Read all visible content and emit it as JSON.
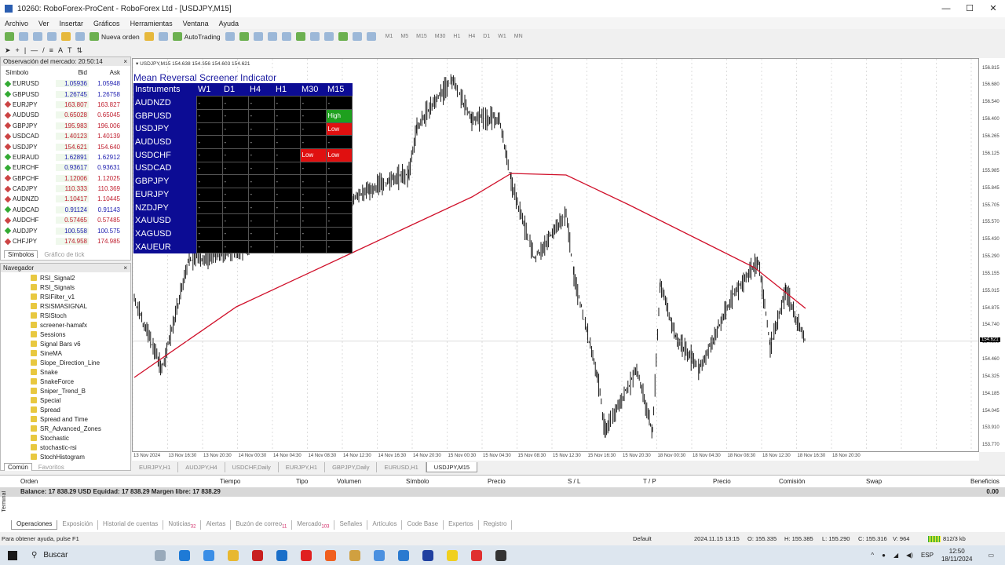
{
  "window": {
    "title": "10260: RoboForex-ProCent - RoboForex Ltd - [USDJPY,M15]",
    "min": "—",
    "max": "☐",
    "close": "✕"
  },
  "menu": [
    "Archivo",
    "Ver",
    "Insertar",
    "Gráficos",
    "Herramientas",
    "Ventana",
    "Ayuda"
  ],
  "toolbar": {
    "new_order": "Nueva orden",
    "autotrading": "AutoTrading",
    "timeframes": [
      "M1",
      "M5",
      "M15",
      "M30",
      "H1",
      "H4",
      "D1",
      "W1",
      "MN"
    ]
  },
  "market_watch": {
    "title": "Observación del mercado: 20:50:14",
    "col_symbol": "Símbolo",
    "col_bid": "Bid",
    "col_ask": "Ask",
    "rows": [
      {
        "symbol": "EURUSD",
        "bid": "1.05936",
        "ask": "1.05948",
        "dir": "up"
      },
      {
        "symbol": "GBPUSD",
        "bid": "1.26745",
        "ask": "1.26758",
        "dir": "up"
      },
      {
        "symbol": "EURJPY",
        "bid": "163.807",
        "ask": "163.827",
        "dir": "down"
      },
      {
        "symbol": "AUDUSD",
        "bid": "0.65028",
        "ask": "0.65045",
        "dir": "down"
      },
      {
        "symbol": "GBPJPY",
        "bid": "195.983",
        "ask": "196.006",
        "dir": "down"
      },
      {
        "symbol": "USDCAD",
        "bid": "1.40123",
        "ask": "1.40139",
        "dir": "down"
      },
      {
        "symbol": "USDJPY",
        "bid": "154.621",
        "ask": "154.640",
        "dir": "down"
      },
      {
        "symbol": "EURAUD",
        "bid": "1.62891",
        "ask": "1.62912",
        "dir": "up"
      },
      {
        "symbol": "EURCHF",
        "bid": "0.93617",
        "ask": "0.93631",
        "dir": "up"
      },
      {
        "symbol": "GBPCHF",
        "bid": "1.12006",
        "ask": "1.12025",
        "dir": "down"
      },
      {
        "symbol": "CADJPY",
        "bid": "110.333",
        "ask": "110.369",
        "dir": "down"
      },
      {
        "symbol": "AUDNZD",
        "bid": "1.10417",
        "ask": "1.10445",
        "dir": "down"
      },
      {
        "symbol": "AUDCAD",
        "bid": "0.91124",
        "ask": "0.91143",
        "dir": "up"
      },
      {
        "symbol": "AUDCHF",
        "bid": "0.57465",
        "ask": "0.57485",
        "dir": "down"
      },
      {
        "symbol": "AUDJPY",
        "bid": "100.558",
        "ask": "100.575",
        "dir": "up"
      },
      {
        "symbol": "CHFJPY",
        "bid": "174.958",
        "ask": "174.985",
        "dir": "down"
      }
    ],
    "tabs": [
      "Símbolos",
      "Gráfico de tick"
    ]
  },
  "navigator": {
    "title": "Navegador",
    "items": [
      "RSI_Signal2",
      "RSI_Signals",
      "RSIFilter_v1",
      "RSISMASIGNAL",
      "RSIStoch",
      "screener-hamafx",
      "Sessions",
      "Signal Bars v6",
      "SineMA",
      "Slope_Direction_Line",
      "Snake",
      "SnakeForce",
      "Sniper_Trend_B",
      "Special",
      "Spread",
      "Spread and Time",
      "SR_Advanced_Zones",
      "Stochastic",
      "stochastic-rsi",
      "StochHistogram"
    ],
    "tabs": [
      "Común",
      "Favoritos"
    ]
  },
  "chart": {
    "info": "▾ USDJPY,M15  154.638 154.656 154.603 154.621",
    "current_price": "154.621",
    "price_labels": [
      "156.815",
      "156.680",
      "156.540",
      "156.400",
      "156.265",
      "156.125",
      "155.985",
      "155.845",
      "155.705",
      "155.570",
      "155.430",
      "155.290",
      "155.155",
      "155.015",
      "154.875",
      "154.740",
      "154.600",
      "154.460",
      "154.325",
      "154.185",
      "154.045",
      "153.910",
      "153.770"
    ],
    "time_labels": [
      "13 Nov 2024",
      "13 Nov 16:30",
      "13 Nov 20:30",
      "14 Nov 00:30",
      "14 Nov 04:30",
      "14 Nov 08:30",
      "14 Nov 12:30",
      "14 Nov 16:30",
      "14 Nov 20:30",
      "15 Nov 00:30",
      "15 Nov 04:30",
      "15 Nov 08:30",
      "15 Nov 12:30",
      "15 Nov 16:30",
      "15 Nov 20:30",
      "18 Nov 00:30",
      "18 Nov 04:30",
      "18 Nov 08:30",
      "18 Nov 12:30",
      "18 Nov 16:30",
      "18 Nov 20:30"
    ],
    "price_color": "#000000",
    "ma_color": "#d0102a",
    "tabs": [
      "EURJPY,H1",
      "AUDJPY,H4",
      "USDCHF,Daily",
      "EURJPY,H1",
      "GBPJPY,Daily",
      "EURUSD,H1",
      "USDJPY,M15"
    ]
  },
  "screener": {
    "title": "Mean Reversal Screener Indicator",
    "header": [
      "Instruments",
      "W1",
      "D1",
      "H4",
      "H1",
      "M30",
      "M15"
    ],
    "rows": [
      {
        "sym": "AUDNZD",
        "cells": [
          "-",
          "-",
          "-",
          "-",
          "-",
          "-"
        ]
      },
      {
        "sym": "GBPUSD",
        "cells": [
          "-",
          "-",
          "-",
          "-",
          "-",
          "High"
        ]
      },
      {
        "sym": "USDJPY",
        "cells": [
          "-",
          "-",
          "-",
          "-",
          "-",
          "Low"
        ]
      },
      {
        "sym": "AUDUSD",
        "cells": [
          "-",
          "-",
          "-",
          "-",
          "-",
          "-"
        ]
      },
      {
        "sym": "USDCHF",
        "cells": [
          "-",
          "-",
          "-",
          "-",
          "Low",
          "Low"
        ]
      },
      {
        "sym": "USDCAD",
        "cells": [
          "-",
          "-",
          "-",
          "-",
          "-",
          "-"
        ]
      },
      {
        "sym": "GBPJPY",
        "cells": [
          "-",
          "-",
          "-",
          "-",
          "-",
          "-"
        ]
      },
      {
        "sym": "EURJPY",
        "cells": [
          "-",
          "-",
          "-",
          "-",
          "-",
          "-"
        ]
      },
      {
        "sym": "NZDJPY",
        "cells": [
          "-",
          "-",
          "-",
          "-",
          "-",
          "-"
        ]
      },
      {
        "sym": "XAUUSD",
        "cells": [
          "-",
          "-",
          "-",
          "-",
          "-",
          "-"
        ]
      },
      {
        "sym": "XAGUSD",
        "cells": [
          "-",
          "-",
          "-",
          "-",
          "-",
          "-"
        ]
      },
      {
        "sym": "XAUEUR",
        "cells": [
          "-",
          "-",
          "-",
          "-",
          "-",
          "-"
        ]
      }
    ],
    "high_color": "#1ea01e",
    "low_color": "#e01010"
  },
  "terminal": {
    "side_label": "Terminal",
    "columns": [
      "Orden",
      "Tiempo",
      "Tipo",
      "Volumen",
      "Símbolo",
      "Precio",
      "S / L",
      "T / P",
      "Precio",
      "Comisión",
      "Swap",
      "Beneficios"
    ],
    "balance": "Balance: 17 838.29 USD  Equidad: 17 838.29  Margen libre: 17 838.29",
    "profit": "0.00",
    "tabs": [
      {
        "label": "Operaciones"
      },
      {
        "label": "Exposición"
      },
      {
        "label": "Historial de cuentas"
      },
      {
        "label": "Noticias",
        "badge": "32"
      },
      {
        "label": "Alertas"
      },
      {
        "label": "Buzón de correo",
        "badge": "11"
      },
      {
        "label": "Mercado",
        "badge": "103"
      },
      {
        "label": "Señales"
      },
      {
        "label": "Artículos"
      },
      {
        "label": "Code Base"
      },
      {
        "label": "Expertos"
      },
      {
        "label": "Registro"
      }
    ]
  },
  "status": {
    "help": "Para obtener ayuda, pulse F1",
    "profile": "Default",
    "time": "2024.11.15 13:15",
    "open": "O: 155.335",
    "high": "H: 155.385",
    "low": "L: 155.290",
    "close": "C: 155.316",
    "volume": "V: 964",
    "traffic": "812/3 kb"
  },
  "taskbar": {
    "search": "Buscar",
    "lang": "ESP",
    "clock_time": "12:50",
    "clock_date": "18/11/2024"
  }
}
